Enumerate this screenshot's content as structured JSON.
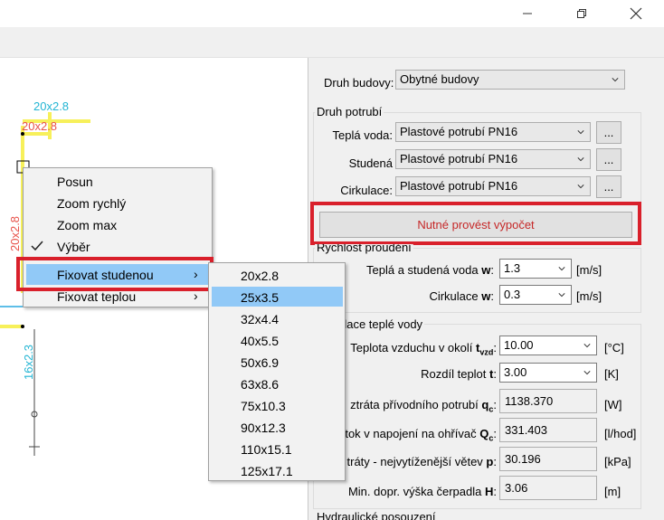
{
  "window": {
    "minimize_icon": "minimize-icon",
    "maximize_icon": "maximize-icon",
    "close_icon": "close-icon"
  },
  "drawing": {
    "labels": [
      "20x2.8",
      "20x2.8",
      "20x2.8",
      "16x2.3"
    ]
  },
  "panel": {
    "druh_budovy_label": "Druh budovy:",
    "druh_budovy_value": "Obytné budovy",
    "druh_potrubi_title": "Druh potrubí",
    "tepla_voda_label": "Teplá voda:",
    "tepla_voda_value": "Plastové potrubí PN16",
    "studena_label": "Studená",
    "studena_value": "Plastové potrubí PN16",
    "cirkulace_label": "Cirkulace:",
    "cirkulace_value": "Plastové potrubí PN16",
    "dots_label": "...",
    "calc_button": "Nutné provést výpočet",
    "rychlost_title": "Rychlost proudění",
    "tepla_studena_label": "Teplá a studená voda",
    "tepla_studena_symbol": "w",
    "tepla_studena_value": "1.3",
    "tepla_studena_unit": "[m/s]",
    "cirk_w_label": "Cirkulace",
    "cirk_w_symbol": "w",
    "cirk_w_value": "0.3",
    "cirk_w_unit": "[m/s]",
    "cirkulace_tv_title": "Cirkulace teplé vody",
    "teplota_label": "Teplota vzduchu v okolí",
    "teplota_symbol": "t",
    "teplota_sub": "vzd",
    "teplota_value": "10.00",
    "teplota_unit": "[°C]",
    "rozdil_label": "Rozdíl teplot",
    "rozdil_symbol": "t",
    "rozdil_value": "3.00",
    "rozdil_unit": "[K]",
    "ztrata_label": "ztráta přívodního potrubí",
    "ztrata_symbol": "q",
    "ztrata_sub": "c",
    "ztrata_value": "1138.370",
    "ztrata_unit": "[W]",
    "prutok_label": "tok v napojení na ohřívač",
    "prutok_symbol": "Q",
    "prutok_sub": "c",
    "prutok_value": "331.403",
    "prutok_unit": "[l/hod]",
    "ztraty_label": "tráty - nejvytíženější větev",
    "ztraty_symbol": "p",
    "ztraty_value": "30.196",
    "ztraty_unit": "[kPa]",
    "vyska_label": "Min. dopr. výška čerpadla",
    "vyska_symbol": "H",
    "vyska_value": "3.06",
    "vyska_unit": "[m]",
    "hydraulicke_title": "Hydraulické posouzení"
  },
  "context_menu": {
    "items": [
      "Posun",
      "Zoom rychlý",
      "Zoom max",
      "Výběr",
      "Fixovat studenou",
      "Fixovat teplou"
    ],
    "checked_item": "Výběr",
    "highlighted_item": "Fixovat studenou"
  },
  "submenu": {
    "items": [
      "20x2.8",
      "25x3.5",
      "32x4.4",
      "40x5.5",
      "50x6.9",
      "63x8.6",
      "75x10.3",
      "90x12.3",
      "110x15.1",
      "125x17.1"
    ],
    "highlighted_item": "25x3.5"
  },
  "colors": {
    "accent_red": "#d9202b",
    "highlight_blue": "#91c9f7",
    "pipe_yellow": "#f7f05a",
    "pipe_label_cyan": "#23b5d3",
    "pipe_label_red": "#e8524a"
  }
}
